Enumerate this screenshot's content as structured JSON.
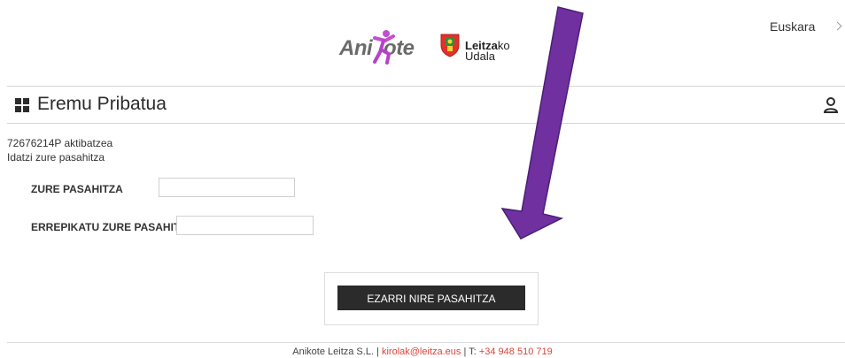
{
  "header": {
    "language": "Euskara",
    "logo_anikote": "Anikote",
    "logo_leitza_line1_bold": "Leitza",
    "logo_leitza_line1_rest": "ko",
    "logo_leitza_line2": "Udala"
  },
  "section": {
    "title": "Eremu Pribatua",
    "icon": "grid-icon",
    "user_icon": "user-icon"
  },
  "form": {
    "intro_line1": "72676214P aktibatzea",
    "intro_line2": "Idatzi zure pasahitza",
    "password_label": "ZURE PASAHITZA",
    "password_value": "",
    "repeat_label": "ERREPIKATU ZURE PASAHITZA",
    "repeat_value": "",
    "submit_label": "EZARRI NIRE PASAHITZA"
  },
  "footer": {
    "company": "Anikote Leitza S.L.",
    "email": "kirolak@leitza.eus",
    "phone_prefix": "T:",
    "phone": "+34 948 510 719",
    "separator": "|"
  },
  "annotation": {
    "arrow_color": "#7030a0"
  }
}
